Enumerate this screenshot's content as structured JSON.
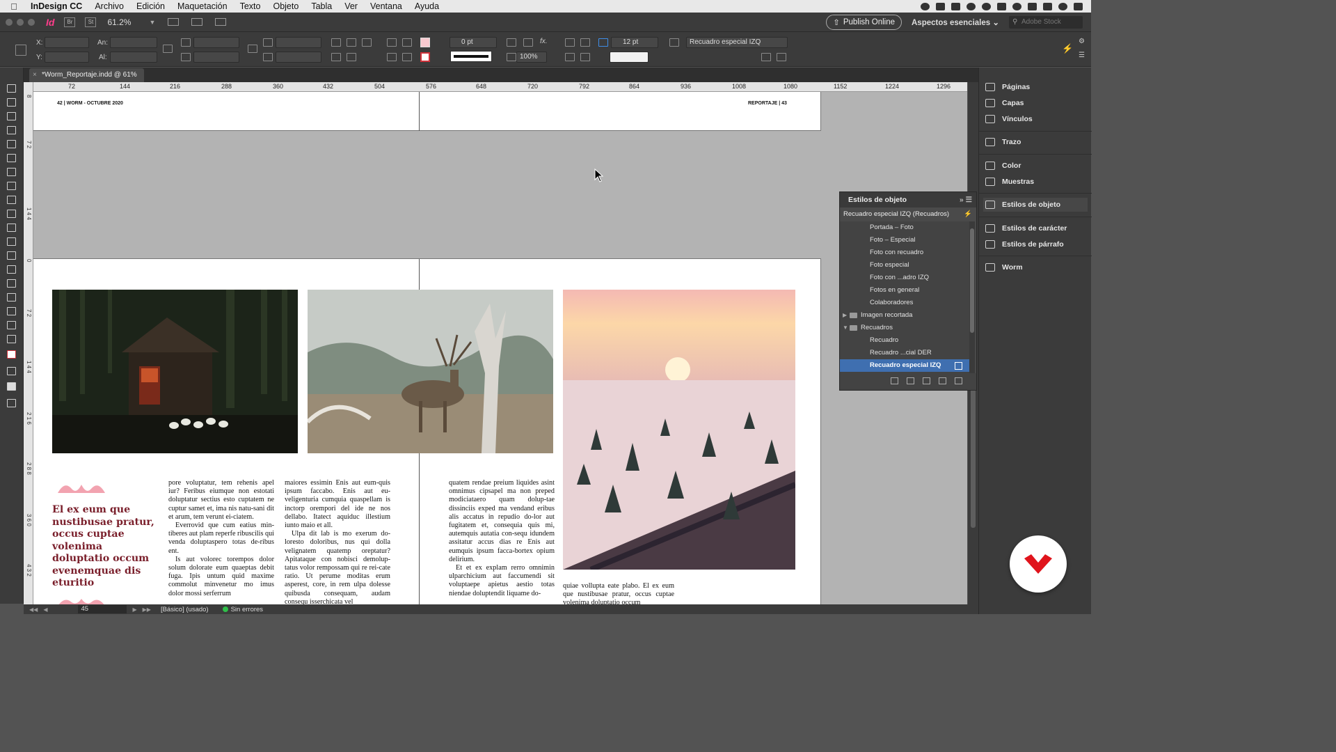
{
  "menubar": {
    "app_name": "InDesign CC",
    "items": [
      "Archivo",
      "Edición",
      "Maquetación",
      "Texto",
      "Objeto",
      "Tabla",
      "Ver",
      "Ventana",
      "Ayuda"
    ]
  },
  "appbar": {
    "logo": "Id",
    "bridge": "Br",
    "stock_btn": "St",
    "zoom": "61.2%",
    "publish_label": "Publish Online",
    "workspace_label": "Aspectos esenciales",
    "search_placeholder": "Adobe Stock"
  },
  "control": {
    "x_label": "X:",
    "y_label": "Y:",
    "w_label": "An:",
    "h_label": "Al:",
    "stroke_weight": "0 pt",
    "scale": "100%",
    "corner_size": "12 pt",
    "object_style": "Recuadro especial IZQ"
  },
  "document": {
    "tab_title": "*Worm_Reportaje.indd @ 61%",
    "folio_left": "42 | WORM - OCTUBRE 2020",
    "folio_right": "REPORTAJE | 43",
    "headline": "El ex eum que nustibusae pratur, occus cuptae volenima doluptatio occum evenemquae dis eturitio",
    "col1_p1": "pore voluptatur, tem rehenis apel iur? Feribus eiumque non estotati doluptatur sectius esto cuptatem ne cuptur samet et, ima nis natu-sani dit et arum, tem verunt ei-ciatem.",
    "col1_p2": "Everrovid que cum eatius min-tiberes aut plam reperfe ribuscilis qui venda doluptaspero totas de-ribus ent.",
    "col1_p3": "Is aut volorec torempos dolor solum dolorate eum quaeptas debit fuga. Ipis untum quid maxime commolut minvenetur mo imus dolor mossi serferrum",
    "col2_p1": "maiores essimin Enis aut eum-quis ipsum faccabo. Enis aut eu-veligenturia cumquia quaspellam is inctorp orempori del ide ne nos dellabo. Itatect aquiduc illestium iunto maio et all.",
    "col2_p2": "Ulpa dit lab is mo exerum do-loresto doloribus, nus qui dolla velignatem quatemp oreptatur? Apitataque con nobisci demolup-tatus volor rempossam qui re rei-cate ratio. Ut perume moditas erum asperest, core, in rem ulpa dolesse quibusda consequam, audam consequ isserchicata vel",
    "col3_p1": "quatem rendae preium liquides asint omnimus cipsapel ma non preped modiciataero quam dolup-tae dissinciis exped ma vendand eribus alis accatus in repudio do-lor aut fugitatem et, consequia quis mi, autemquis autatia con-sequ idundem assitatur accus dias re Enis aut eumquis ipsum facca-bortex opium delirium.",
    "col3_p2": "Et et ex explam rerro omnimin ulparchicium aut faccumendi sit voluptaepe apietus aestio totas niendae doluptendit liquame do-",
    "col4_p1": "quiae vollupta eate plabo. El ex eum que nustibusae pratur, occus cuptae volenima doluptatio occum"
  },
  "ruler": {
    "labels": [
      "72",
      "144",
      "216",
      "288",
      "360",
      "432",
      "504",
      "576",
      "648",
      "720",
      "792",
      "864",
      "936",
      "1008",
      "1080",
      "1152",
      "1224",
      "1296"
    ],
    "vertical": [
      "8",
      "7 2",
      "1 4 4",
      "0",
      "7 2",
      "1 4 4",
      "2 1 6",
      "2 8 8",
      "3 6 0",
      "4 3 2"
    ]
  },
  "dock": {
    "items": [
      "Páginas",
      "Capas",
      "Vínculos",
      "Trazo",
      "Color",
      "Muestras",
      "Estilos de objeto",
      "Estilos de carácter",
      "Estilos de párrafo",
      "Worm"
    ]
  },
  "object_styles": {
    "title": "Estilos de objeto",
    "current": "Recuadro especial IZQ (Recuadros)",
    "items": [
      {
        "label": "Portada – Foto",
        "type": "style"
      },
      {
        "label": "Foto – Especial",
        "type": "style"
      },
      {
        "label": "Foto con recuadro",
        "type": "style"
      },
      {
        "label": "Foto especial",
        "type": "style"
      },
      {
        "label": "Foto con ...adro IZQ",
        "type": "style"
      },
      {
        "label": "Fotos en general",
        "type": "style"
      },
      {
        "label": "Colaboradores",
        "type": "style"
      },
      {
        "label": "Imagen recortada",
        "type": "group-collapsed"
      },
      {
        "label": "Recuadros",
        "type": "group-open"
      },
      {
        "label": "Recuadro",
        "type": "style"
      },
      {
        "label": "Recuadro ...cial DER",
        "type": "style"
      },
      {
        "label": "Recuadro especial IZQ",
        "type": "selected"
      }
    ]
  },
  "status": {
    "page": "45",
    "master": "[Básico] (usado)",
    "preflight": "Sin errores"
  },
  "colors": {
    "accent": "#ff3d8b",
    "headline": "#7a1f2b",
    "selection": "#3f6fb0",
    "preflight_ok": "#2fbf4a",
    "brand": "#e0141c"
  }
}
